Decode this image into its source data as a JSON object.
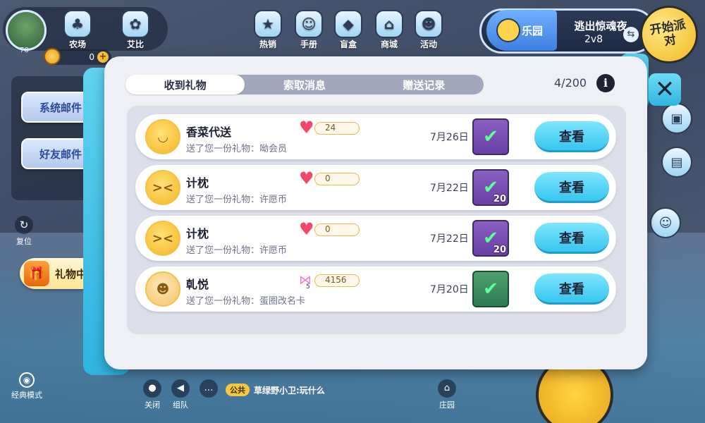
{
  "hud": {
    "avatar_level": "78",
    "coins": "0",
    "top_nav": [
      {
        "label": "农场",
        "icon": "farm-icon"
      },
      {
        "label": "艾比",
        "icon": "abby-icon"
      },
      {
        "label": "热销",
        "icon": "hot-sale-icon"
      },
      {
        "label": "手册",
        "icon": "handbook-icon"
      },
      {
        "label": "盲盒",
        "icon": "blind-box-icon"
      },
      {
        "label": "商城",
        "icon": "shop-icon"
      },
      {
        "label": "活动",
        "icon": "event-icon"
      }
    ],
    "paradise_label": "乐园",
    "mode_title": "逃出惊魂夜",
    "mode_sub": "2v8",
    "start_party": "开始派对",
    "mail_tabs": [
      "系统邮件",
      "好友邮件"
    ],
    "gift_center": "礼物中心",
    "reset_label": "复位",
    "classic_mode": "经典模式",
    "mute_label": "关闭",
    "team_label": "组队",
    "home_label": "庄园",
    "chat_tag": "公共",
    "chat_text": "草绿野小卫:玩什么"
  },
  "modal": {
    "tabs": [
      "收到礼物",
      "索取消息",
      "赠送记录"
    ],
    "active_tab": 0,
    "count": "4/200",
    "info_icon": "i",
    "close_icon": "✕",
    "view_label": "查看",
    "rows": [
      {
        "name": "香菜代送",
        "message": "送了您一份礼物：呦会员",
        "like_type": "heart",
        "likes": "24",
        "date": "7月26日",
        "gift_color": "purple",
        "gift_qty": ""
      },
      {
        "name": "计枕",
        "message": "送了您一份礼物：许愿币",
        "like_type": "heart",
        "likes": "0",
        "date": "7月22日",
        "gift_color": "purple",
        "gift_qty": "20"
      },
      {
        "name": "计枕",
        "message": "送了您一份礼物：许愿币",
        "like_type": "heart",
        "likes": "0",
        "date": "7月22日",
        "gift_color": "purple",
        "gift_qty": "20"
      },
      {
        "name": "乹悦",
        "message": "送了您一份礼物：蛋圈改名卡",
        "like_type": "bow",
        "bow_level": "5",
        "likes": "4156",
        "date": "7月20日",
        "gift_color": "green",
        "gift_qty": ""
      }
    ]
  }
}
